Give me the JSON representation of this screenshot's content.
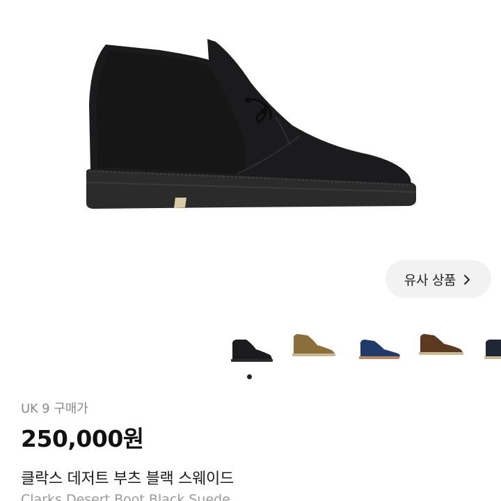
{
  "product": {
    "size_label": "UK 9",
    "price_type": "구매가",
    "price": "250,000원",
    "name_ko": "클락스 데저트 부츠 블랙 스웨이드",
    "name_en": "Clarks Desert Boot Black Suede"
  },
  "similar": {
    "label": "유사 상품",
    "icon": "chevron-right-icon"
  },
  "thumbnails": [
    {
      "name": "black-suede",
      "color": "#1c1c1e"
    },
    {
      "name": "olive-suede",
      "color": "#8a6f3b"
    },
    {
      "name": "navy-suede",
      "color": "#1f3a6b"
    },
    {
      "name": "brown-suede",
      "color": "#5b3a20"
    },
    {
      "name": "dark-navy",
      "color": "#202633"
    }
  ],
  "carousel": {
    "current_index": 1,
    "total": 1
  }
}
